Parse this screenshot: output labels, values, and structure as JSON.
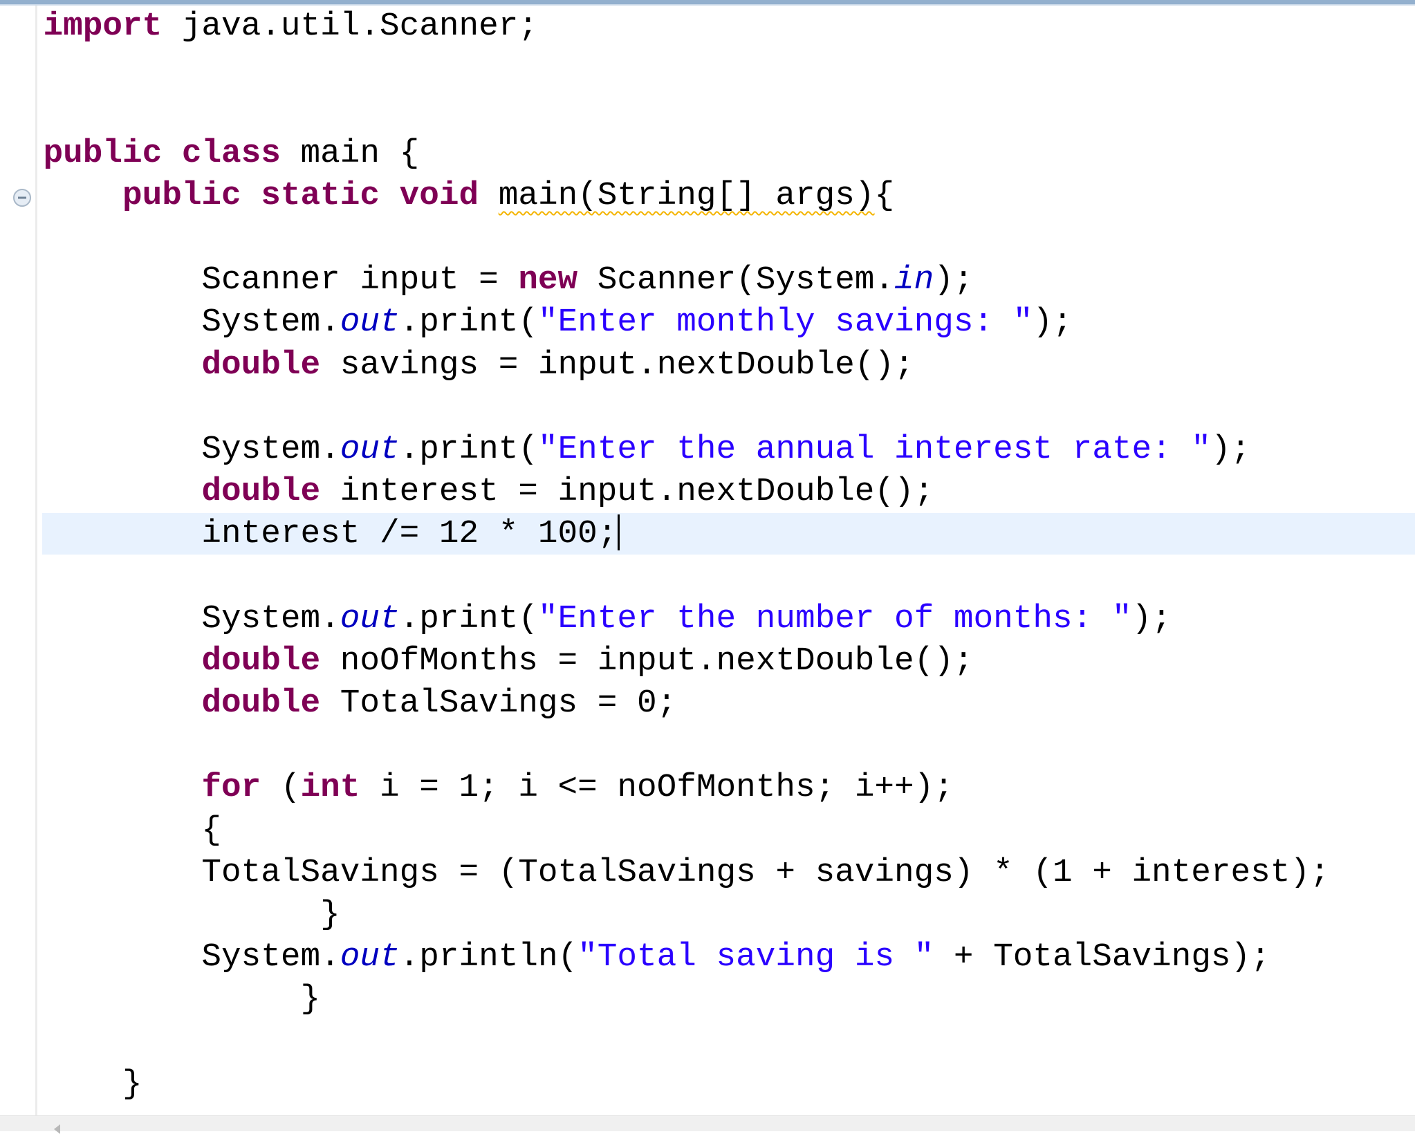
{
  "editor": {
    "language": "java",
    "current_line_index": 12,
    "colors": {
      "keyword": "#7F0055",
      "string": "#2A00FF",
      "static_field": "#0000C0",
      "plain": "#000000",
      "current_line_highlight": "#E8F2FE",
      "warning_underline": "#F4B400",
      "title_bar": "#93B0CE"
    },
    "fold_icon": "collapse-minus-icon",
    "lines": [
      [
        {
          "t": "keyword",
          "v": "import"
        },
        {
          "t": "plain",
          "v": " java.util.Scanner;"
        }
      ],
      [],
      [],
      [
        {
          "t": "keyword",
          "v": "public"
        },
        {
          "t": "plain",
          "v": " "
        },
        {
          "t": "keyword",
          "v": "class"
        },
        {
          "t": "plain",
          "v": " main {"
        }
      ],
      [
        {
          "t": "plain",
          "v": "    "
        },
        {
          "t": "keyword",
          "v": "public"
        },
        {
          "t": "plain",
          "v": " "
        },
        {
          "t": "keyword",
          "v": "static"
        },
        {
          "t": "plain",
          "v": " "
        },
        {
          "t": "keyword",
          "v": "void"
        },
        {
          "t": "plain",
          "v": " "
        },
        {
          "t": "warning",
          "v": "main(String[] args)"
        },
        {
          "t": "plain",
          "v": "{"
        }
      ],
      [],
      [
        {
          "t": "plain",
          "v": "        Scanner input = "
        },
        {
          "t": "keyword",
          "v": "new"
        },
        {
          "t": "plain",
          "v": " Scanner(System."
        },
        {
          "t": "static",
          "v": "in"
        },
        {
          "t": "plain",
          "v": ");"
        }
      ],
      [
        {
          "t": "plain",
          "v": "        System."
        },
        {
          "t": "static",
          "v": "out"
        },
        {
          "t": "plain",
          "v": ".print("
        },
        {
          "t": "string",
          "v": "\"Enter monthly savings: \""
        },
        {
          "t": "plain",
          "v": ");"
        }
      ],
      [
        {
          "t": "plain",
          "v": "        "
        },
        {
          "t": "keyword",
          "v": "double"
        },
        {
          "t": "plain",
          "v": " savings = input.nextDouble();"
        }
      ],
      [],
      [
        {
          "t": "plain",
          "v": "        System."
        },
        {
          "t": "static",
          "v": "out"
        },
        {
          "t": "plain",
          "v": ".print("
        },
        {
          "t": "string",
          "v": "\"Enter the annual interest rate: \""
        },
        {
          "t": "plain",
          "v": ");"
        }
      ],
      [
        {
          "t": "plain",
          "v": "        "
        },
        {
          "t": "keyword",
          "v": "double"
        },
        {
          "t": "plain",
          "v": " interest = input.nextDouble();"
        }
      ],
      [
        {
          "t": "plain",
          "v": "        interest /= 12 * 100;"
        },
        {
          "t": "caret",
          "v": ""
        }
      ],
      [],
      [
        {
          "t": "plain",
          "v": "        System."
        },
        {
          "t": "static",
          "v": "out"
        },
        {
          "t": "plain",
          "v": ".print("
        },
        {
          "t": "string",
          "v": "\"Enter the number of months: \""
        },
        {
          "t": "plain",
          "v": ");"
        }
      ],
      [
        {
          "t": "plain",
          "v": "        "
        },
        {
          "t": "keyword",
          "v": "double"
        },
        {
          "t": "plain",
          "v": " noOfMonths = input.nextDouble();"
        }
      ],
      [
        {
          "t": "plain",
          "v": "        "
        },
        {
          "t": "keyword",
          "v": "double"
        },
        {
          "t": "plain",
          "v": " TotalSavings = 0;"
        }
      ],
      [],
      [
        {
          "t": "plain",
          "v": "        "
        },
        {
          "t": "keyword",
          "v": "for"
        },
        {
          "t": "plain",
          "v": " ("
        },
        {
          "t": "keyword",
          "v": "int"
        },
        {
          "t": "plain",
          "v": " i = 1; i <= noOfMonths; i++);"
        }
      ],
      [
        {
          "t": "plain",
          "v": "        {"
        }
      ],
      [
        {
          "t": "plain",
          "v": "        TotalSavings = (TotalSavings + savings) * (1 + interest);"
        }
      ],
      [
        {
          "t": "plain",
          "v": "              }"
        }
      ],
      [
        {
          "t": "plain",
          "v": "        System."
        },
        {
          "t": "static",
          "v": "out"
        },
        {
          "t": "plain",
          "v": ".println("
        },
        {
          "t": "string",
          "v": "\"Total saving is \""
        },
        {
          "t": "plain",
          "v": " + TotalSavings);"
        }
      ],
      [
        {
          "t": "plain",
          "v": "             }"
        }
      ],
      [],
      [
        {
          "t": "plain",
          "v": "    }"
        }
      ]
    ]
  }
}
